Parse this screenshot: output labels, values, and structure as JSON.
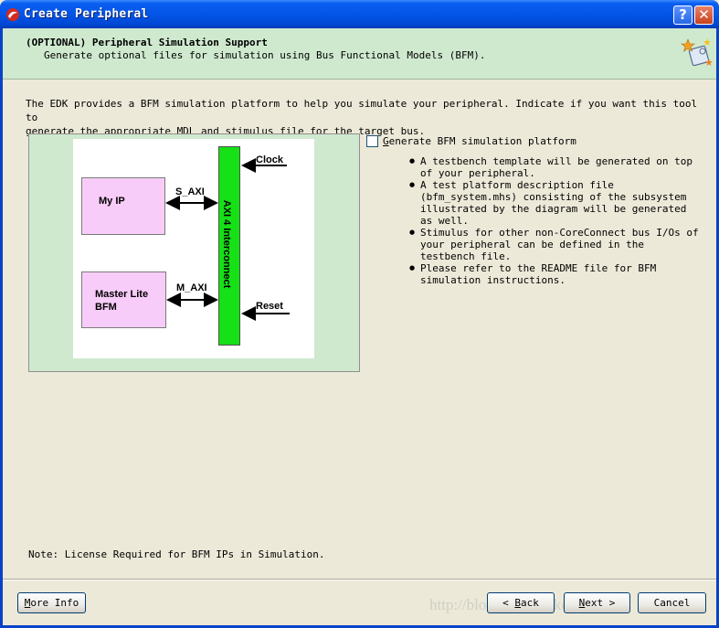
{
  "window": {
    "title": "Create Peripheral"
  },
  "header": {
    "title": "(OPTIONAL) Peripheral Simulation Support",
    "subtitle": "Generate optional files for simulation using Bus Functional Models (BFM)."
  },
  "intro": "The EDK provides a BFM simulation platform to help you simulate your peripheral. Indicate if you want this tool to\ngenerate the appropriate MDL and stimulus file for the target bus.",
  "diagram": {
    "my_ip": "My IP",
    "master_lite": "Master Lite",
    "master_lite_2": "BFM",
    "s_axi": "S_AXI",
    "m_axi": "M_AXI",
    "interconnect": "AXI 4 Interconnect",
    "clock": "Clock",
    "reset": "Reset"
  },
  "option": {
    "label": "Generate BFM simulation platform",
    "checked": false
  },
  "bullets": [
    "A testbench template will be generated on top of your peripheral.",
    "A test platform description file (bfm_system.mhs) consisting of the subsystem illustrated by the diagram will be generated as well.",
    "Stimulus for other non-CoreConnect bus I/Os of your peripheral can be defined in the testbench file.",
    "Please refer to the README file for BFM simulation instructions."
  ],
  "note": "Note: License Required for BFM IPs in Simulation.",
  "buttons": {
    "more_info": {
      "first": "M",
      "rest": "ore Info"
    },
    "back": {
      "prefix": "< ",
      "first": "B",
      "rest": "ack"
    },
    "next": {
      "first": "N",
      "rest": "ext >"
    },
    "cancel": "Cancel"
  },
  "watermark": "http://blog.csdn.net/keyizhao"
}
